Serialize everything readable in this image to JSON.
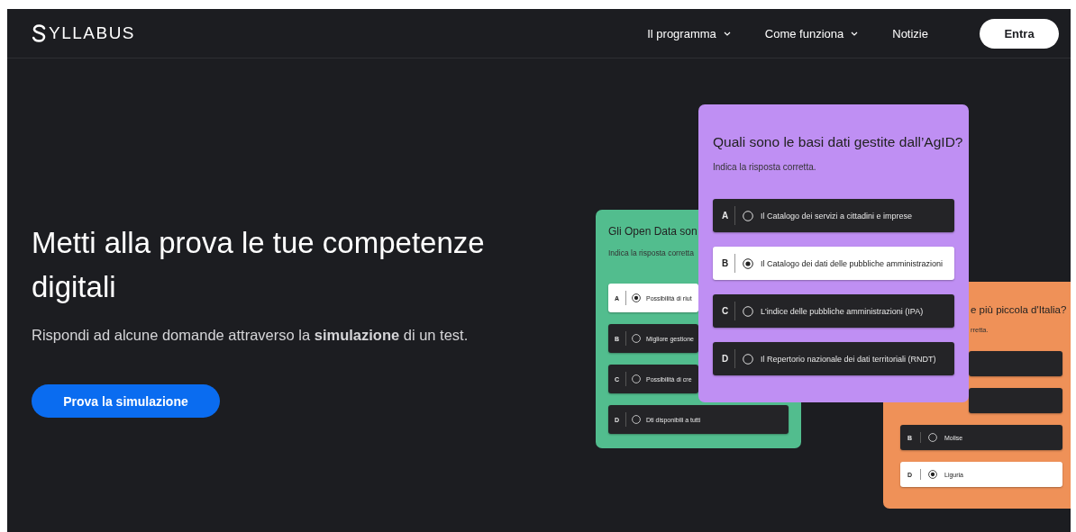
{
  "header": {
    "logo": "YLLABUS",
    "nav": [
      {
        "label": "Il programma",
        "dropdown": true
      },
      {
        "label": "Come funziona",
        "dropdown": true
      },
      {
        "label": "Notizie",
        "dropdown": false
      }
    ],
    "login_button": "Entra"
  },
  "hero": {
    "headline": "Metti alla prova le tue competenze digitali",
    "text": "Rispondi ad alcune domande attraverso la **simulazione** di un test.",
    "button": "Prova la simulazione"
  },
  "cards": [
    {
      "kind": "back-left",
      "color": "#52bd8e",
      "title": "Gli Open Data son",
      "subtitle": "Indica la risposta  corretta",
      "options": [
        {
          "letter": "A",
          "text": "Possibilità di riut",
          "selected": true
        },
        {
          "letter": "B",
          "text": "Migliore gestione",
          "selected": false
        },
        {
          "letter": "C",
          "text": "Possibilità di cre",
          "selected": false
        },
        {
          "letter": "D",
          "text": "Dti disponibili a tutti",
          "selected": false
        }
      ]
    },
    {
      "kind": "back-right",
      "color": "#ef9158",
      "title": "e più piccola d'Italia?",
      "subtitle": "rretta.",
      "options": [
        {
          "selected": false
        },
        {
          "selected": false
        },
        {
          "letter": "B",
          "text": "Molise",
          "selected": false
        },
        {
          "letter": "D",
          "text": "Liguria",
          "selected": true
        }
      ]
    },
    {
      "kind": "front",
      "color": "#bf8ff3",
      "title": "Quali sono le basi dati gestite dall’AgID?",
      "subtitle": "Indica la risposta  corretta.",
      "options": [
        {
          "letter": "A",
          "text": "Il Catalogo dei servizi a cittadini e imprese",
          "selected": false
        },
        {
          "letter": "B",
          "text": "Il Catalogo dei dati delle pubbliche amministrazioni",
          "selected": true
        },
        {
          "letter": "C",
          "text": "L'indice delle pubbliche amministrazioni (IPA)",
          "selected": false
        },
        {
          "letter": "D",
          "text": "Il Repertorio nazionale dei dati territoriali (RNDT)",
          "selected": false
        }
      ]
    }
  ]
}
